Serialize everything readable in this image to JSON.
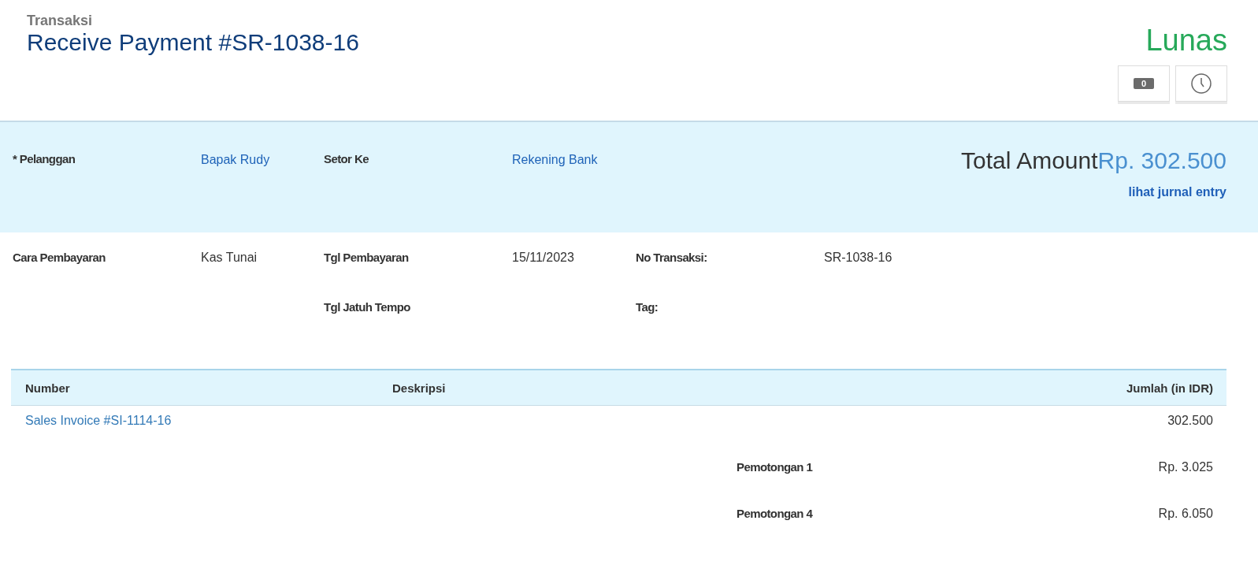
{
  "header": {
    "breadcrumb": "Transaksi",
    "title": "Receive Payment #SR-1038-16",
    "status": "Lunas"
  },
  "actions": [
    {
      "kind": "comments",
      "count": "0"
    },
    {
      "kind": "history"
    }
  ],
  "summary": {
    "fields": [
      {
        "label": "* Pelanggan",
        "value": "Bapak Rudy"
      },
      {
        "label": "Setor Ke",
        "value": "Rekening Bank"
      }
    ],
    "total_label": "Total Amount",
    "total_amount": "Rp. 302.500",
    "journal_link": "lihat jurnal entry"
  },
  "details": [
    {
      "fields": [
        {
          "label": "Cara Pembayaran",
          "value": "Kas Tunai"
        }
      ]
    },
    {
      "fields": [
        {
          "label": "Tgl Pembayaran",
          "value": "15/11/2023"
        },
        {
          "label": "Tgl Jatuh Tempo"
        }
      ]
    },
    {
      "fields": [
        {
          "label": "No Transaksi:",
          "value": "SR-1038-16"
        },
        {
          "label": "Tag:"
        }
      ]
    }
  ],
  "table": {
    "columns": [
      "Number",
      "Deskripsi",
      "Jumlah (in IDR)"
    ],
    "rows": [
      {
        "number": "Sales Invoice #SI-1114-16",
        "amount": "302.500"
      }
    ],
    "deductions": [
      {
        "label": "Pemotongan 1",
        "amount": "Rp. 3.025"
      },
      {
        "label": "Pemotongan 4",
        "amount": "Rp. 6.050"
      }
    ]
  }
}
